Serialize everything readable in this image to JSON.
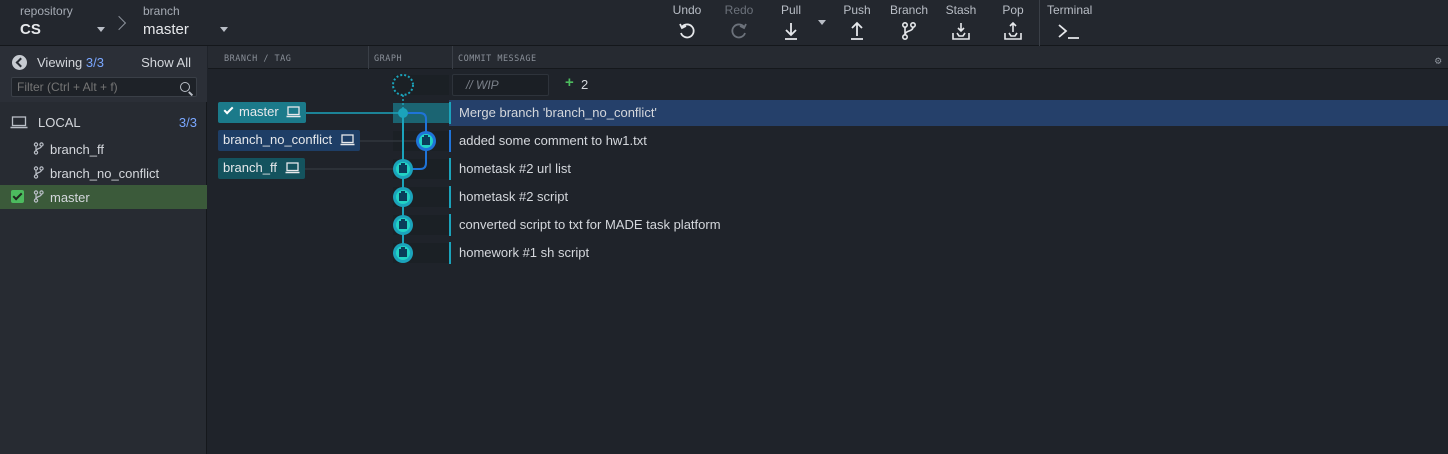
{
  "toolbar": {
    "repository_label": "repository",
    "repository_name": "CS",
    "branch_label": "branch",
    "branch_name": "master",
    "undo": "Undo",
    "redo": "Redo",
    "pull": "Pull",
    "push": "Push",
    "branch": "Branch",
    "stash": "Stash",
    "pop": "Pop",
    "terminal": "Terminal"
  },
  "sidebar": {
    "viewing_label": "Viewing",
    "viewing_count": "3/3",
    "show_all": "Show All",
    "filter_placeholder": "Filter (Ctrl + Alt + f)",
    "local_label": "LOCAL",
    "local_count": "3/3",
    "branches": [
      {
        "name": "branch_ff",
        "active": false
      },
      {
        "name": "branch_no_conflict",
        "active": false
      },
      {
        "name": "master",
        "active": true
      }
    ]
  },
  "columns": {
    "branch_tag": "BRANCH / TAG",
    "graph": "GRAPH",
    "commit_message": "COMMIT MESSAGE"
  },
  "wip": {
    "placeholder": "// WIP",
    "plus": "+",
    "count": "2"
  },
  "refs": {
    "master": "master",
    "branch_no_conflict": "branch_no_conflict",
    "branch_ff": "branch_ff"
  },
  "commits": [
    {
      "message": "Merge branch 'branch_no_conflict'"
    },
    {
      "message": "added some comment to hw1.txt"
    },
    {
      "message": "hometask #2 url list"
    },
    {
      "message": "hometask #2 script"
    },
    {
      "message": "converted script to txt for MADE task platform"
    },
    {
      "message": "homework #1 sh script"
    }
  ],
  "colors": {
    "teal": "#1ba3bb",
    "blue": "#1f74d9",
    "green": "#4cbb5e",
    "selected_row": "#25406a"
  },
  "icons": {
    "undo": "undo-icon",
    "redo": "redo-icon",
    "pull": "pull-icon",
    "push": "push-icon",
    "branch": "branch-icon",
    "stash": "stash-icon",
    "pop": "pop-icon",
    "terminal": "terminal-icon"
  }
}
